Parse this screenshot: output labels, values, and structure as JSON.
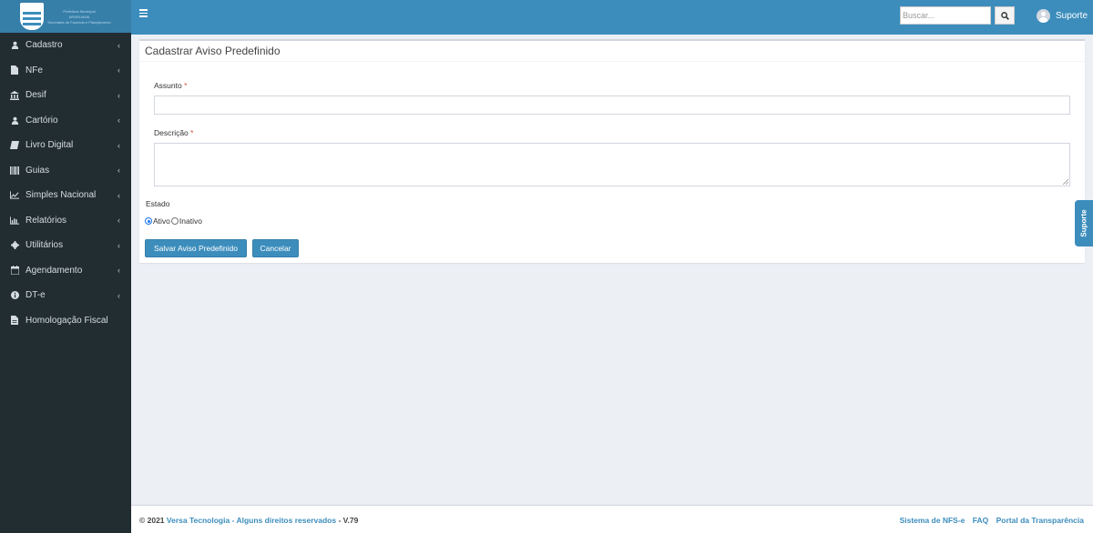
{
  "app": {
    "logo_text_lines": [
      "Prefeitura Municipal",
      "ARARUAMA",
      "Secretaria de Fazenda e Planejamento"
    ]
  },
  "colors": {
    "brand_blue": "#3c8dbc",
    "sidebar_bg": "#222d32",
    "required_red": "#dd4b39"
  },
  "sidebar": {
    "items": [
      {
        "label": "Cadastro",
        "icon": "user-icon",
        "has_children": true
      },
      {
        "label": "NFe",
        "icon": "file-icon",
        "has_children": true
      },
      {
        "label": "Desif",
        "icon": "bank-icon",
        "has_children": true
      },
      {
        "label": "Cartório",
        "icon": "user-icon",
        "has_children": true
      },
      {
        "label": "Livro Digital",
        "icon": "book-icon",
        "has_children": true
      },
      {
        "label": "Guias",
        "icon": "barcode-icon",
        "has_children": true
      },
      {
        "label": "Simples Nacional",
        "icon": "line-chart-icon",
        "has_children": true
      },
      {
        "label": "Relatórios",
        "icon": "bar-chart-icon",
        "has_children": true
      },
      {
        "label": "Utilitários",
        "icon": "gear-icon",
        "has_children": true
      },
      {
        "label": "Agendamento",
        "icon": "calendar-icon",
        "has_children": true
      },
      {
        "label": "DT-e",
        "icon": "info-icon",
        "has_children": true
      },
      {
        "label": "Homologação Fiscal",
        "icon": "document-icon",
        "has_children": false
      }
    ]
  },
  "header": {
    "search_placeholder": "Buscar...",
    "user_name": "Suporte"
  },
  "form": {
    "title": "Cadastrar Aviso Predefinido",
    "assunto_label": "Assunto",
    "descricao_label": "Descrição",
    "required_mark": "*",
    "assunto_value": "",
    "descricao_value": "",
    "estado_label": "Estado",
    "options": {
      "ativo": "Ativo",
      "inativo": "Inativo"
    },
    "selected_estado": "Ativo",
    "save_label": "Salvar Aviso Predefinido",
    "cancel_label": "Cancelar"
  },
  "support_tab": {
    "label": "Suporte"
  },
  "footer": {
    "copyright": "© 2021",
    "company": "Versa Tecnologia",
    "separator": "-",
    "rights": "Alguns direitos reservados",
    "version": "V.79",
    "links": [
      "Sistema de NFS-e",
      "FAQ",
      "Portal da Transparência"
    ]
  }
}
